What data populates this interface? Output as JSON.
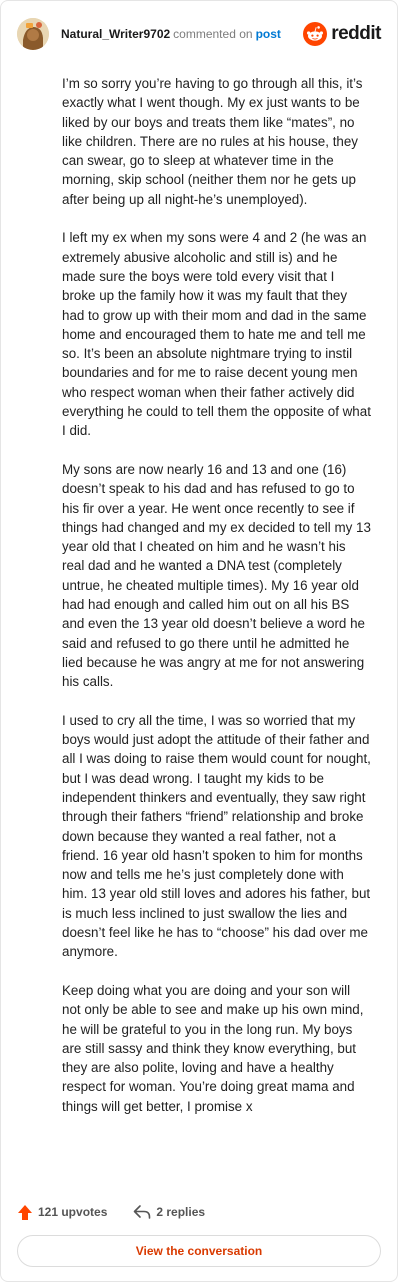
{
  "header": {
    "username": "Natural_Writer9702",
    "action_text": "commented on",
    "post_link": "post",
    "brand_name": "reddit"
  },
  "comment": {
    "paragraphs": [
      "I’m so sorry you’re having to go through all this, it’s exactly what I went though. My ex just wants to be liked by our boys and treats them like “mates”, no like children. There are no rules at his house, they can swear, go to sleep at whatever time in the morning, skip school (neither them nor he gets up after being up all night-he’s unemployed).",
      "I left my ex when my sons were 4 and 2 (he was an extremely abusive alcoholic and still is) and he made sure the boys were told every visit that I broke up the family how it was my fault that they had to grow up with their mom and dad in the same home and encouraged them to hate me and tell me so. It’s been an absolute nightmare trying to instil boundaries and for me to raise decent young men who respect woman when their father actively did everything he could to tell them the opposite of what I did.",
      "My sons are now nearly 16 and 13 and one (16) doesn’t speak to his dad and has refused to go to his fir over a year. He went once recently to see if things had changed and my ex decided to tell my 13 year old that I cheated on him and he wasn’t his real dad and he wanted a DNA test (completely untrue, he cheated multiple times). My 16 year old had had enough and called him out on all his BS and even the 13 year old doesn’t believe a word he said and refused to go there until he admitted he lied because he was angry at me for not answering his calls.",
      "I used to cry all the time, I was so worried that my boys would just adopt the attitude of their father and all I was doing to raise them would count for nought, but I was dead wrong. I taught my kids to be independent thinkers and eventually, they saw right through their fathers “friend” relationship and broke down because they wanted a real father, not a friend. 16 year old hasn’t spoken to him for months now and tells me he’s just completely done with him. 13 year old still loves and adores his father, but is much less inclined to just swallow the lies and doesn’t feel like he has to “choose” his dad over me anymore.",
      "Keep doing what you are doing and your son will not only be able to see and make up his own mind, he will be grateful to you in the long run. My boys are still sassy and think they know everything, but they are also polite, loving and have a healthy respect for woman. You’re doing great mama and things will get better, I promise x"
    ]
  },
  "footer": {
    "upvotes": "121 upvotes",
    "replies": "2 replies",
    "view_button": "View the conversation"
  },
  "colors": {
    "reddit_orange": "#ff4500",
    "link_blue": "#0079d3",
    "button_text": "#d93a00"
  },
  "icons": [
    "avatar",
    "reddit-logo-icon",
    "upvote-arrow-icon",
    "reply-arrow-icon"
  ]
}
